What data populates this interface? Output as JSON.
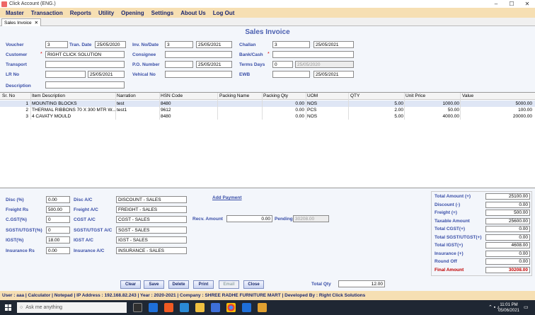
{
  "window": {
    "title": "Click Account (ENG.)",
    "minimize": "–",
    "maximize": "☐",
    "close": "✕"
  },
  "menu": [
    "Master",
    "Transaction",
    "Reports",
    "Utility",
    "Opening",
    "Settings",
    "About Us",
    "Log Out"
  ],
  "tab": {
    "label": "Sales Invoice",
    "close": "✕"
  },
  "form": {
    "title": "Sales Invoice",
    "voucher_label": "Voucher",
    "voucher": "3",
    "tran_date_label": "Tran. Date",
    "tran_date": "25/05/2020",
    "inv_label": "Inv. No/Date",
    "inv_no": "3",
    "inv_date": "25/05/2021",
    "challan_label": "Challan",
    "challan_no": "3",
    "challan_date": "25/05/2021",
    "customer_label": "Customer",
    "customer": "RIGHT CLICK SOLUTION",
    "consignee_label": "Consignee",
    "consignee": "",
    "bankcash_label": "Bank/Cash",
    "bankcash": "",
    "transport_label": "Transport",
    "transport": "",
    "po_label": "P.O. Number",
    "po_no": "",
    "po_date": "25/05/2021",
    "terms_label": "Terms Days",
    "terms_days": "0",
    "terms_date": "25/05/2020",
    "lr_label": "LR No",
    "lr_no": "",
    "lr_date": "25/05/2021",
    "vehical_label": "Vehical No",
    "vehical": "",
    "ewb_label": "EWB",
    "ewb_no": "",
    "ewb_date": "25/05/2021",
    "description_label": "Description",
    "description": "",
    "required_mark": "*"
  },
  "grid": {
    "headers": [
      "Sr. No",
      "Item Description",
      "Narration",
      "HSN Code",
      "Packing Name",
      "Packing Qty",
      "UOM",
      "QTY",
      "Unit Price",
      "Value"
    ],
    "rows": [
      {
        "sr": "1",
        "item": "MOUNTING BLOCKS",
        "narration": "test",
        "hsn": "8480",
        "packing_name": "",
        "packing_qty": "0.00",
        "uom": "NOS",
        "qty": "5.00",
        "price": "1000.00",
        "value": "5000.00"
      },
      {
        "sr": "2",
        "item": "THERMAL RIBBONS 70 X 300 MTR W...",
        "narration": "test1",
        "hsn": "9612",
        "packing_name": "",
        "packing_qty": "0.00",
        "uom": "PCS",
        "qty": "2.00",
        "price": "50.00",
        "value": "100.00"
      },
      {
        "sr": "3",
        "item": "4 CAVATY MOULD",
        "narration": "",
        "hsn": "8480",
        "packing_name": "",
        "packing_qty": "0.00",
        "uom": "NOS",
        "qty": "5.00",
        "price": "4000.00",
        "value": "20000.00"
      }
    ]
  },
  "charges": {
    "disc_label": "Disc (%)",
    "disc": "0.00",
    "disc_ac_label": "Disc A/C",
    "disc_ac": "DISCOUNT - SALES",
    "freight_label": "Freight Rs",
    "freight": "500.00",
    "freight_ac_label": "Freight A/C",
    "freight_ac": "FREIGHT - SALES",
    "cgst_label": "C.GST(%)",
    "cgst": "0",
    "cgst_ac_label": "CGST A/C",
    "cgst_ac": "CGST - SALES",
    "sgst_label": "SGST/UTGST(%)",
    "sgst": "0",
    "sgst_ac_label": "SGST/UTGST A/C",
    "sgst_ac": "SGST - SALES",
    "igst_label": "IGST(%)",
    "igst": "18.00",
    "igst_ac_label": "IGST A/C",
    "igst_ac": "IGST - SALES",
    "ins_label": "Insurance Rs",
    "ins": "0.00",
    "ins_ac_label": "Insurance A/C",
    "ins_ac": "INSURANCE - SALES"
  },
  "payment": {
    "add_payment": "Add Payment",
    "recv_label": "Recv. Amount",
    "recv": "0.00",
    "pending_label": "Pending",
    "pending": "30208.00"
  },
  "totals": [
    {
      "label": "Total Amount (+)",
      "value": "25100.00"
    },
    {
      "label": "Discount (-)",
      "value": "0.00"
    },
    {
      "label": "Freight (+)",
      "value": "500.00"
    },
    {
      "label": "Taxable Amount",
      "value": "25600.00"
    },
    {
      "label": "Total CGST(+)",
      "value": "0.00"
    },
    {
      "label": "Total SGST/UTGST(+)",
      "value": "0.00"
    },
    {
      "label": "Total IGST(+)",
      "value": "4608.00"
    },
    {
      "label": "Insurance (+)",
      "value": "0.00"
    },
    {
      "label": "Round Off",
      "value": "0.00"
    },
    {
      "label": "Final Amount",
      "value": "30208.00"
    }
  ],
  "buttons": {
    "clear": "Clear",
    "save": "Save",
    "delete": "Delete",
    "print": "Print",
    "email": "Email",
    "close": "Close"
  },
  "total_qty": {
    "label": "Total Qty",
    "value": "12.00"
  },
  "status": "User :  aaa  |  Calculator  |  Notepad  |  IP Address :  192.168.82.243  |  Year :  2020-2021  |  Company :  SHREE RADHE FURNITURE MART  |  Developed By :  Right Click Solutions",
  "taskbar": {
    "search_placeholder": "Ask me anything",
    "time": "11:01 PM",
    "date": "05/06/2021"
  },
  "colors": {
    "menu_bg": "#f6dfb3",
    "label": "#3a4fa8",
    "final": "#c00000",
    "taskbar": "#1f2733"
  }
}
